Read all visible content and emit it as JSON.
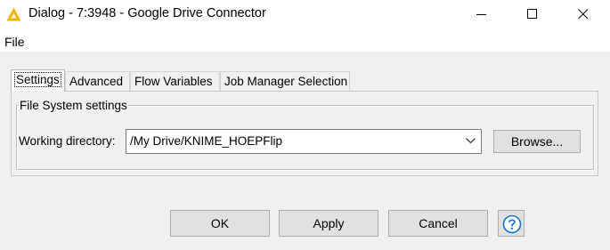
{
  "window": {
    "title": "Dialog - 7:3948 - Google Drive Connector",
    "app_icon": "knime-triangle-icon",
    "controls": [
      "minimize-icon",
      "maximize-icon",
      "close-icon"
    ]
  },
  "menu": {
    "file": "File"
  },
  "tabs": [
    {
      "label": "Settings",
      "active": true
    },
    {
      "label": "Advanced",
      "active": false
    },
    {
      "label": "Flow Variables",
      "active": false
    },
    {
      "label": "Job Manager Selection",
      "active": false
    }
  ],
  "file_system_settings": {
    "legend": "File System settings",
    "working_directory_label": "Working directory:",
    "working_directory_value": "/My Drive/KNIME_HOEPFlip",
    "browse_label": "Browse..."
  },
  "buttons": {
    "ok": "OK",
    "apply": "Apply",
    "cancel": "Cancel",
    "help_icon": "help-question-icon"
  },
  "colors": {
    "background": "#f0f0f0",
    "titlebar": "#ffffff",
    "app_icon": "#f2b600",
    "help_icon": "#1a73c8"
  }
}
